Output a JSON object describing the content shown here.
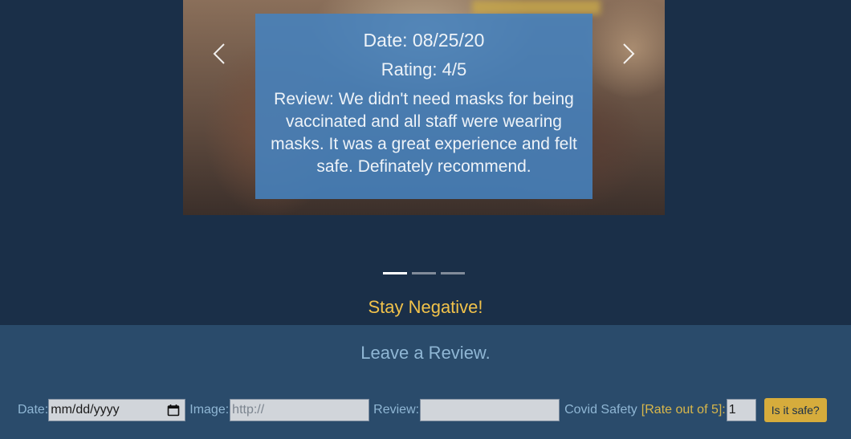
{
  "carousel": {
    "slide": {
      "date": "Date: 08/25/20",
      "rating": "Rating: 4/5",
      "review": "Review: We didn't need masks for being vaccinated and all staff were wearing masks. It was a great experience and felt safe. Definately recommend."
    },
    "prev_icon": "chevron-left-icon",
    "next_icon": "chevron-right-icon",
    "indicator_count": 3,
    "active_indicator": 0
  },
  "tagline": "Stay Negative!",
  "review_form": {
    "title": "Leave a Review.",
    "date_label": "Date:",
    "date_placeholder": "mm/dd/yyyy",
    "date_icon": "calendar-icon",
    "image_label": "Image:",
    "image_placeholder": "http://",
    "review_label": "Review:",
    "review_value": "",
    "safety_label": "Covid Safety",
    "rate_hint": "[Rate out of 5]:",
    "rating_value": "1",
    "submit_label": "Is it safe?"
  },
  "colors": {
    "background": "#1a2f48",
    "panel": "#2a4b6b",
    "accent_yellow": "#f1c24a",
    "button": "#d6ac3c",
    "caption": "#4682be"
  }
}
